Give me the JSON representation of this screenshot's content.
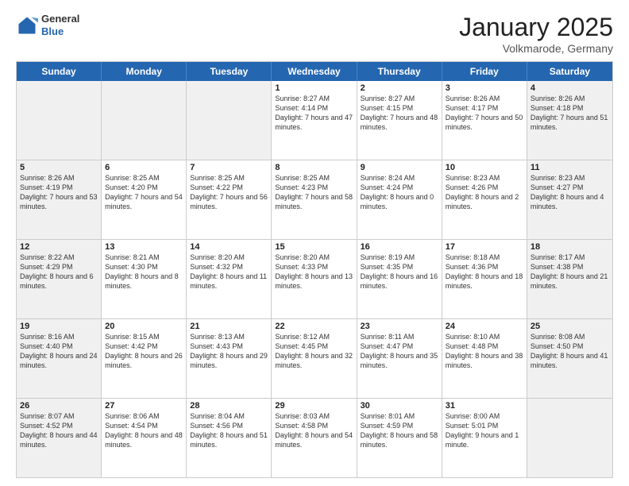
{
  "header": {
    "logo_general": "General",
    "logo_blue": "Blue",
    "title": "January 2025",
    "location": "Volkmarode, Germany"
  },
  "days": [
    "Sunday",
    "Monday",
    "Tuesday",
    "Wednesday",
    "Thursday",
    "Friday",
    "Saturday"
  ],
  "rows": [
    [
      {
        "date": "",
        "text": "",
        "shaded": true
      },
      {
        "date": "",
        "text": "",
        "shaded": true
      },
      {
        "date": "",
        "text": "",
        "shaded": true
      },
      {
        "date": "1",
        "text": "Sunrise: 8:27 AM\nSunset: 4:14 PM\nDaylight: 7 hours and 47 minutes.",
        "shaded": false
      },
      {
        "date": "2",
        "text": "Sunrise: 8:27 AM\nSunset: 4:15 PM\nDaylight: 7 hours and 48 minutes.",
        "shaded": false
      },
      {
        "date": "3",
        "text": "Sunrise: 8:26 AM\nSunset: 4:17 PM\nDaylight: 7 hours and 50 minutes.",
        "shaded": false
      },
      {
        "date": "4",
        "text": "Sunrise: 8:26 AM\nSunset: 4:18 PM\nDaylight: 7 hours and 51 minutes.",
        "shaded": true
      }
    ],
    [
      {
        "date": "5",
        "text": "Sunrise: 8:26 AM\nSunset: 4:19 PM\nDaylight: 7 hours and 53 minutes.",
        "shaded": true
      },
      {
        "date": "6",
        "text": "Sunrise: 8:25 AM\nSunset: 4:20 PM\nDaylight: 7 hours and 54 minutes.",
        "shaded": false
      },
      {
        "date": "7",
        "text": "Sunrise: 8:25 AM\nSunset: 4:22 PM\nDaylight: 7 hours and 56 minutes.",
        "shaded": false
      },
      {
        "date": "8",
        "text": "Sunrise: 8:25 AM\nSunset: 4:23 PM\nDaylight: 7 hours and 58 minutes.",
        "shaded": false
      },
      {
        "date": "9",
        "text": "Sunrise: 8:24 AM\nSunset: 4:24 PM\nDaylight: 8 hours and 0 minutes.",
        "shaded": false
      },
      {
        "date": "10",
        "text": "Sunrise: 8:23 AM\nSunset: 4:26 PM\nDaylight: 8 hours and 2 minutes.",
        "shaded": false
      },
      {
        "date": "11",
        "text": "Sunrise: 8:23 AM\nSunset: 4:27 PM\nDaylight: 8 hours and 4 minutes.",
        "shaded": true
      }
    ],
    [
      {
        "date": "12",
        "text": "Sunrise: 8:22 AM\nSunset: 4:29 PM\nDaylight: 8 hours and 6 minutes.",
        "shaded": true
      },
      {
        "date": "13",
        "text": "Sunrise: 8:21 AM\nSunset: 4:30 PM\nDaylight: 8 hours and 8 minutes.",
        "shaded": false
      },
      {
        "date": "14",
        "text": "Sunrise: 8:20 AM\nSunset: 4:32 PM\nDaylight: 8 hours and 11 minutes.",
        "shaded": false
      },
      {
        "date": "15",
        "text": "Sunrise: 8:20 AM\nSunset: 4:33 PM\nDaylight: 8 hours and 13 minutes.",
        "shaded": false
      },
      {
        "date": "16",
        "text": "Sunrise: 8:19 AM\nSunset: 4:35 PM\nDaylight: 8 hours and 16 minutes.",
        "shaded": false
      },
      {
        "date": "17",
        "text": "Sunrise: 8:18 AM\nSunset: 4:36 PM\nDaylight: 8 hours and 18 minutes.",
        "shaded": false
      },
      {
        "date": "18",
        "text": "Sunrise: 8:17 AM\nSunset: 4:38 PM\nDaylight: 8 hours and 21 minutes.",
        "shaded": true
      }
    ],
    [
      {
        "date": "19",
        "text": "Sunrise: 8:16 AM\nSunset: 4:40 PM\nDaylight: 8 hours and 24 minutes.",
        "shaded": true
      },
      {
        "date": "20",
        "text": "Sunrise: 8:15 AM\nSunset: 4:42 PM\nDaylight: 8 hours and 26 minutes.",
        "shaded": false
      },
      {
        "date": "21",
        "text": "Sunrise: 8:13 AM\nSunset: 4:43 PM\nDaylight: 8 hours and 29 minutes.",
        "shaded": false
      },
      {
        "date": "22",
        "text": "Sunrise: 8:12 AM\nSunset: 4:45 PM\nDaylight: 8 hours and 32 minutes.",
        "shaded": false
      },
      {
        "date": "23",
        "text": "Sunrise: 8:11 AM\nSunset: 4:47 PM\nDaylight: 8 hours and 35 minutes.",
        "shaded": false
      },
      {
        "date": "24",
        "text": "Sunrise: 8:10 AM\nSunset: 4:48 PM\nDaylight: 8 hours and 38 minutes.",
        "shaded": false
      },
      {
        "date": "25",
        "text": "Sunrise: 8:08 AM\nSunset: 4:50 PM\nDaylight: 8 hours and 41 minutes.",
        "shaded": true
      }
    ],
    [
      {
        "date": "26",
        "text": "Sunrise: 8:07 AM\nSunset: 4:52 PM\nDaylight: 8 hours and 44 minutes.",
        "shaded": true
      },
      {
        "date": "27",
        "text": "Sunrise: 8:06 AM\nSunset: 4:54 PM\nDaylight: 8 hours and 48 minutes.",
        "shaded": false
      },
      {
        "date": "28",
        "text": "Sunrise: 8:04 AM\nSunset: 4:56 PM\nDaylight: 8 hours and 51 minutes.",
        "shaded": false
      },
      {
        "date": "29",
        "text": "Sunrise: 8:03 AM\nSunset: 4:58 PM\nDaylight: 8 hours and 54 minutes.",
        "shaded": false
      },
      {
        "date": "30",
        "text": "Sunrise: 8:01 AM\nSunset: 4:59 PM\nDaylight: 8 hours and 58 minutes.",
        "shaded": false
      },
      {
        "date": "31",
        "text": "Sunrise: 8:00 AM\nSunset: 5:01 PM\nDaylight: 9 hours and 1 minute.",
        "shaded": false
      },
      {
        "date": "",
        "text": "",
        "shaded": true
      }
    ]
  ]
}
